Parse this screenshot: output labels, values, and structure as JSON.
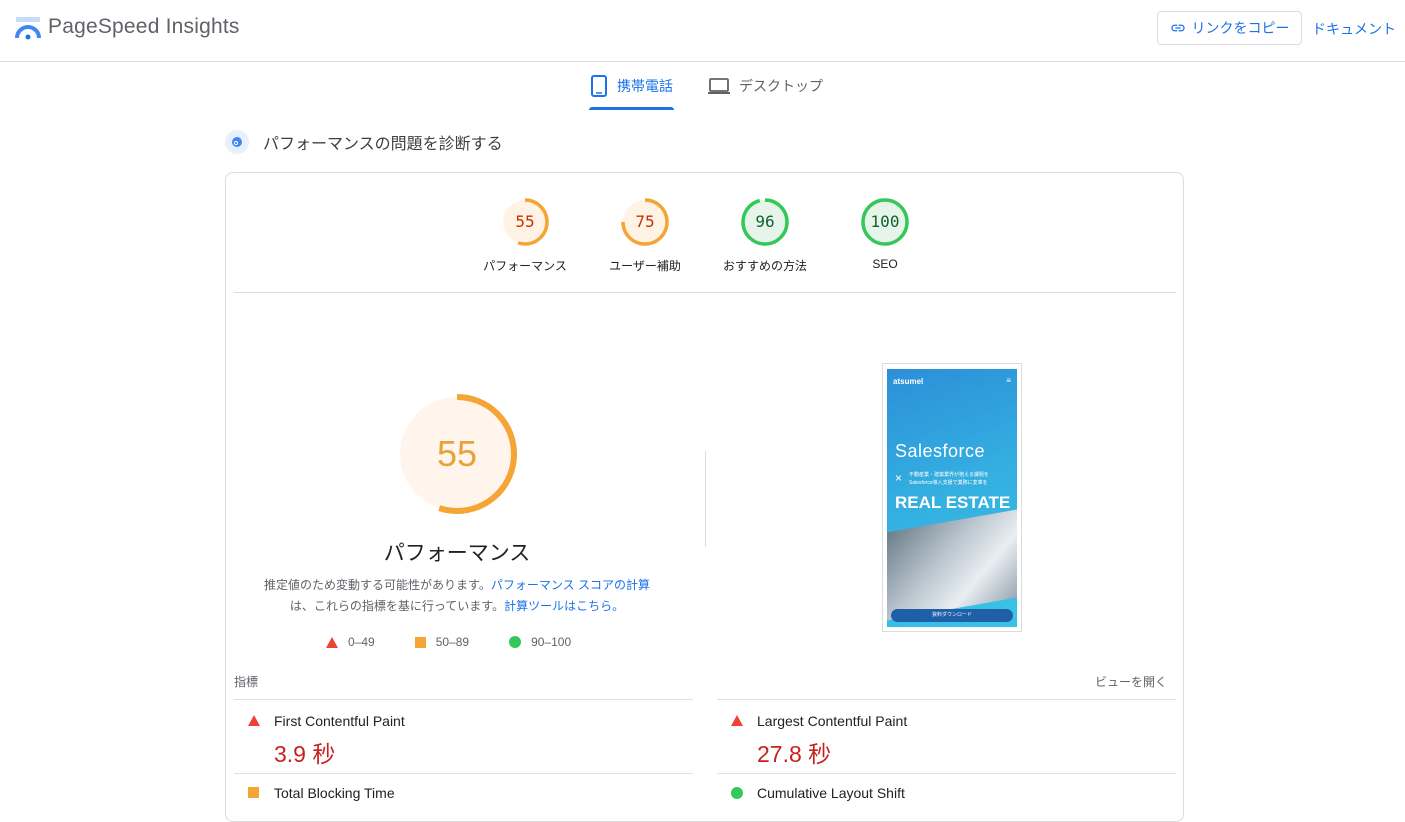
{
  "header": {
    "brand": "PageSpeed Insights",
    "copy_link_label": "リンクをコピー",
    "docs_label": "ドキュメント"
  },
  "tabs": [
    {
      "label": "携帯電話",
      "icon": "smartphone-icon",
      "active": true
    },
    {
      "label": "デスクトップ",
      "icon": "laptop-icon",
      "active": false
    }
  ],
  "diagnose": {
    "title": "パフォーマンスの問題を診断する"
  },
  "scores": [
    {
      "value": "55",
      "label": "パフォーマンス",
      "color": "#e8710a",
      "fraction": 0.55
    },
    {
      "value": "75",
      "label": "ユーザー補助",
      "color": "#e8710a",
      "fraction": 0.75
    },
    {
      "value": "96",
      "label": "おすすめの方法",
      "color": "#0d652d",
      "fraction": 0.96
    },
    {
      "value": "100",
      "label": "SEO",
      "color": "#0d652d",
      "fraction": 1.0
    }
  ],
  "performance": {
    "score": "55",
    "fraction": 0.55,
    "title": "パフォーマンス",
    "desc_1": "推定値のため変動する可能性があります。",
    "desc_link_1": "パフォーマンス スコアの計算",
    "desc_2": "は、これらの指標を基に行っています。",
    "desc_link_2": "計算ツールはこちら。"
  },
  "legend": [
    {
      "label": "0–49",
      "shape": "triangle",
      "color": "#eb4335"
    },
    {
      "label": "50–89",
      "shape": "square",
      "color": "#f4a534"
    },
    {
      "label": "90–100",
      "shape": "circle",
      "color": "#34c759"
    }
  ],
  "screenshot": {
    "logo": "atsumel",
    "headline": "Salesforce",
    "cross": "×",
    "sub": "不動産業・建築業界が抱える課題を Salesforce導入支援で業務に変革を",
    "real_estate": "REAL ESTATE",
    "button": "資料ダウンロード"
  },
  "metrics": {
    "header": "指標",
    "open_view": "ビューを開く",
    "items": [
      {
        "name": "First Contentful Paint",
        "value": "3.9 秒",
        "status": "poor"
      },
      {
        "name": "Largest Contentful Paint",
        "value": "27.8 秒",
        "status": "poor"
      }
    ],
    "partial_items": [
      {
        "name": "Total Blocking Time",
        "status": "average"
      },
      {
        "name": "Cumulative Layout Shift",
        "status": "good"
      }
    ]
  },
  "colors": {
    "accent": "#1a73e8",
    "poor": "#c5221f",
    "average_ring": "#f4a534",
    "good_ring": "#34c759"
  }
}
